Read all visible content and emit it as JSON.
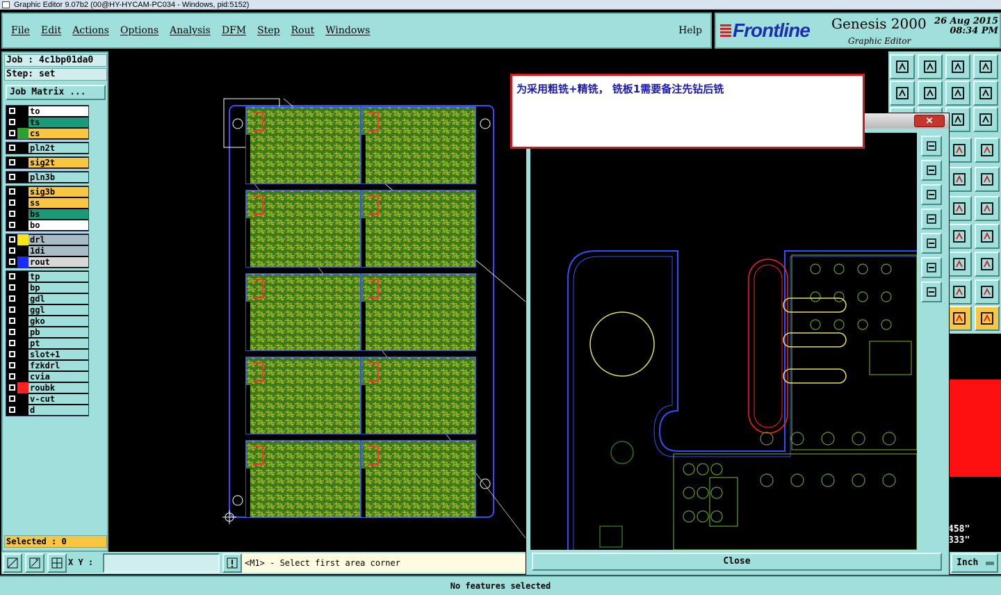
{
  "window": {
    "title": "Graphic Editor 9.07b2 (00@HY-HYCAM-PC034 - Windows, pid:5152)"
  },
  "menu": {
    "items": [
      "File",
      "Edit",
      "Actions",
      "Options",
      "Analysis",
      "DFM",
      "Step",
      "Rout",
      "Windows"
    ],
    "help": "Help"
  },
  "brand": {
    "logo": "Frontline",
    "product": "Genesis 2000",
    "subtitle": "Graphic Editor",
    "date": "26 Aug 2015",
    "time": "08:34 PM"
  },
  "job": {
    "job_line": "Job : 4c1bp01da0",
    "step_line": "Step: set",
    "job_matrix": "Job Matrix ..."
  },
  "layer_groups": [
    [
      {
        "name": "to",
        "color": "#ffffff"
      },
      {
        "name": "ts",
        "color": "#1a9a78"
      },
      {
        "name": "cs",
        "color": "#f9c642"
      }
    ],
    [
      {
        "name": "pln2t",
        "color": "#9fe0dc"
      }
    ],
    [
      {
        "name": "sig2t",
        "color": "#f9c642"
      }
    ],
    [
      {
        "name": "pln3b",
        "color": "#9fe0dc"
      }
    ],
    [
      {
        "name": "sig3b",
        "color": "#f9c642"
      },
      {
        "name": "ss",
        "color": "#f9c642"
      },
      {
        "name": "bs",
        "color": "#1a9a78"
      },
      {
        "name": "bo",
        "color": "#ffffff"
      }
    ],
    [
      {
        "name": "drl",
        "color": "#a8bcc8"
      },
      {
        "name": "1di",
        "color": "#a8bcc8"
      },
      {
        "name": "rout",
        "color": "#d8d8d8"
      }
    ],
    [
      {
        "name": "tp",
        "color": "#9fe0dc"
      },
      {
        "name": "bp",
        "color": "#9fe0dc"
      },
      {
        "name": "gdl",
        "color": "#9fe0dc"
      },
      {
        "name": "ggl",
        "color": "#9fe0dc"
      },
      {
        "name": "gko",
        "color": "#9fe0dc"
      },
      {
        "name": "pb",
        "color": "#9fe0dc"
      },
      {
        "name": "pt",
        "color": "#9fe0dc"
      },
      {
        "name": "slot+1",
        "color": "#9fe0dc"
      },
      {
        "name": "fzkdrl",
        "color": "#9fe0dc"
      },
      {
        "name": "cvia",
        "color": "#9fe0dc"
      },
      {
        "name": "roubk",
        "color": "#9fe0dc"
      },
      {
        "name": "v-cut",
        "color": "#9fe0dc"
      },
      {
        "name": "d",
        "color": "#9fe0dc"
      }
    ]
  ],
  "layer_swatches": {
    "cs": "#2fa02f",
    "drl": "#f5e61a",
    "1di": "#000000",
    "rout": "#1a2bff",
    "roubk": "#ff2020"
  },
  "selected": "Selected : 0",
  "note": "为采用粗铣+精铣， 铣板1需要备注先钻后铣",
  "subwindow": {
    "close_label": "Close",
    "close_x": "✕"
  },
  "right_panel": {
    "coord1": "458\"",
    "coord2": "333\""
  },
  "bottom": {
    "xy_label": "X Y :",
    "xy_value": "",
    "prompt": "<M1> - Select first area corner",
    "units": "Inch"
  },
  "status": "No features selected"
}
